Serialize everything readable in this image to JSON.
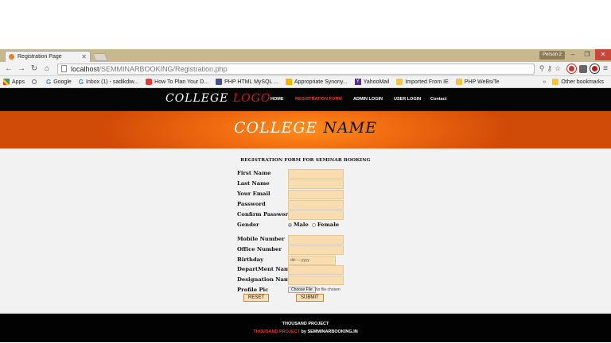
{
  "browser": {
    "tab_title": "Registration Page",
    "profile": "Person 2",
    "url_host": "localhost",
    "url_path": "/SEMMINARBOOKING/Registration.php",
    "bookmarks": [
      {
        "label": "Apps",
        "icon": "apps-grid-icon"
      },
      {
        "label": "",
        "icon": "search-icon"
      },
      {
        "label": "Google",
        "icon": "google-icon"
      },
      {
        "label": "Inbox (1) - sadikdiw...",
        "icon": "google-icon"
      },
      {
        "label": "How To Plan Your D...",
        "icon": "youtube-icon"
      },
      {
        "label": "PHP HTML MySQL ...",
        "icon": "php-icon"
      },
      {
        "label": "Appropriate Synony...",
        "icon": "thesaurus-icon"
      },
      {
        "label": "YahooMail",
        "icon": "yahoo-icon"
      },
      {
        "label": "Imported From IE",
        "icon": "folder-icon"
      },
      {
        "label": "PHP WeBsiTe",
        "icon": "folder-icon"
      }
    ],
    "more_bookmarks": "»",
    "other_bookmarks": "Other bookmarks"
  },
  "site": {
    "logo_part1": "COLLEGE",
    "logo_part2": "LOGO",
    "nav": {
      "home": "HOME",
      "registration": "REGISTRATION FORM",
      "admin": "ADMIN LOGIN",
      "user": "USER LOGIN",
      "contact": "Contact"
    },
    "banner_part1": "COLLEGE",
    "banner_part2": "NAME"
  },
  "form": {
    "heading": "REGISTRATION FORM FOR SEMINAR BOOKING",
    "first_name": "First Name",
    "last_name": "Last Name",
    "email": "Your Email",
    "password": "Password",
    "confirm_password": "Confirm Password",
    "gender": "Gender",
    "gender_male": "Male",
    "gender_female": "Female",
    "mobile": "Mobile Number",
    "office": "Office Number",
    "birthday": "Birthday",
    "birthday_placeholder": "dd-----yyyy",
    "department": "DepartMent Name",
    "designation": "Designation Name",
    "profile_pic": "Profile Pic",
    "choose_file": "Choose File",
    "no_file": "No file chosen",
    "reset": "RESET",
    "submit": "SUBMIT"
  },
  "footer": {
    "line1": "THOUSAND PROJECT",
    "line2_red": "THOUSAND PROJECT",
    "line2_white": "by SEMMINARBOOKING.IN"
  },
  "colors": {
    "banner": "#f06a10",
    "field": "#f9ddb0",
    "nav_active": "#e53935",
    "logo_accent": "#d4161a"
  }
}
